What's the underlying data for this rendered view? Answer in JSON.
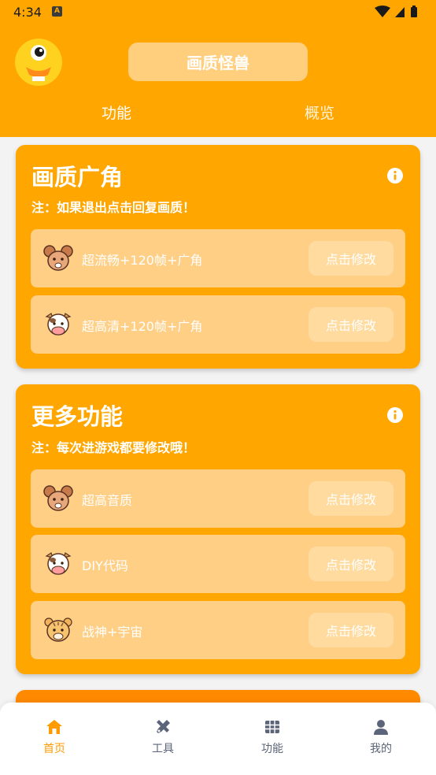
{
  "status_bar": {
    "time": "4:34",
    "notif_icon": "a-icon"
  },
  "header": {
    "title": "画质怪兽",
    "tabs": [
      {
        "label": "功能",
        "active": true
      },
      {
        "label": "概览",
        "active": false
      }
    ]
  },
  "cards": [
    {
      "title": "画质广角",
      "note": "注：如果退出点击回复画质！",
      "rows": [
        {
          "icon": "mouse-icon",
          "label": "超流畅+120帧+广角",
          "button": "点击修改"
        },
        {
          "icon": "cow-icon",
          "label": "超高清+120帧+广角",
          "button": "点击修改"
        }
      ]
    },
    {
      "title": "更多功能",
      "note": "注：每次进游戏都要修改哦！",
      "rows": [
        {
          "icon": "mouse-icon",
          "label": "超高音质",
          "button": "点击修改"
        },
        {
          "icon": "cow-icon",
          "label": "DIY代码",
          "button": "点击修改"
        },
        {
          "icon": "tiger-icon",
          "label": "战神+宇宙",
          "button": "点击修改"
        }
      ]
    }
  ],
  "bottom_nav": [
    {
      "icon": "home-icon",
      "label": "首页",
      "active": true
    },
    {
      "icon": "tools-icon",
      "label": "工具",
      "active": false
    },
    {
      "icon": "grid-icon",
      "label": "功能",
      "active": false
    },
    {
      "icon": "user-icon",
      "label": "我的",
      "active": false
    }
  ],
  "colors": {
    "accent": "#ffa600",
    "card_row": "#ffcf86",
    "button": "#ffdb9f",
    "nav_active": "#ff9a00",
    "nav_inactive": "#5b6478"
  }
}
